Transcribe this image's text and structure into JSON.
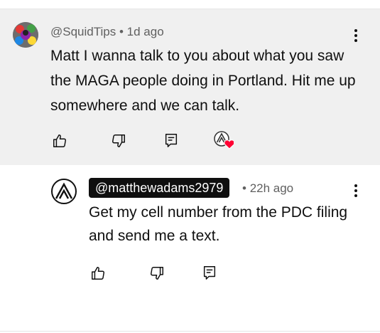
{
  "comment": {
    "author": "@SquidTips",
    "separator": "•",
    "time": "1d ago",
    "text": "Matt I wanna talk to you about what you saw the MAGA people doing in Portland. Hit me up somewhere and we can talk.",
    "actions": {
      "like_icon": "thumbs-up-icon",
      "dislike_icon": "thumbs-down-icon",
      "reply_icon": "reply-icon",
      "creator_heart_icon": "creator-heart-icon"
    }
  },
  "reply": {
    "author": "@matthewadams2979",
    "separator": "•",
    "time": "22h ago",
    "text": "Get my cell number from the PDC filing and send me a text.",
    "actions": {
      "like_icon": "thumbs-up-icon",
      "dislike_icon": "thumbs-down-icon",
      "reply_icon": "reply-icon"
    }
  },
  "colors": {
    "highlight_bg": "#f0f0f0",
    "meta_text": "#606060",
    "heart": "#ff0033",
    "chip_bg": "#0f0f0f"
  }
}
